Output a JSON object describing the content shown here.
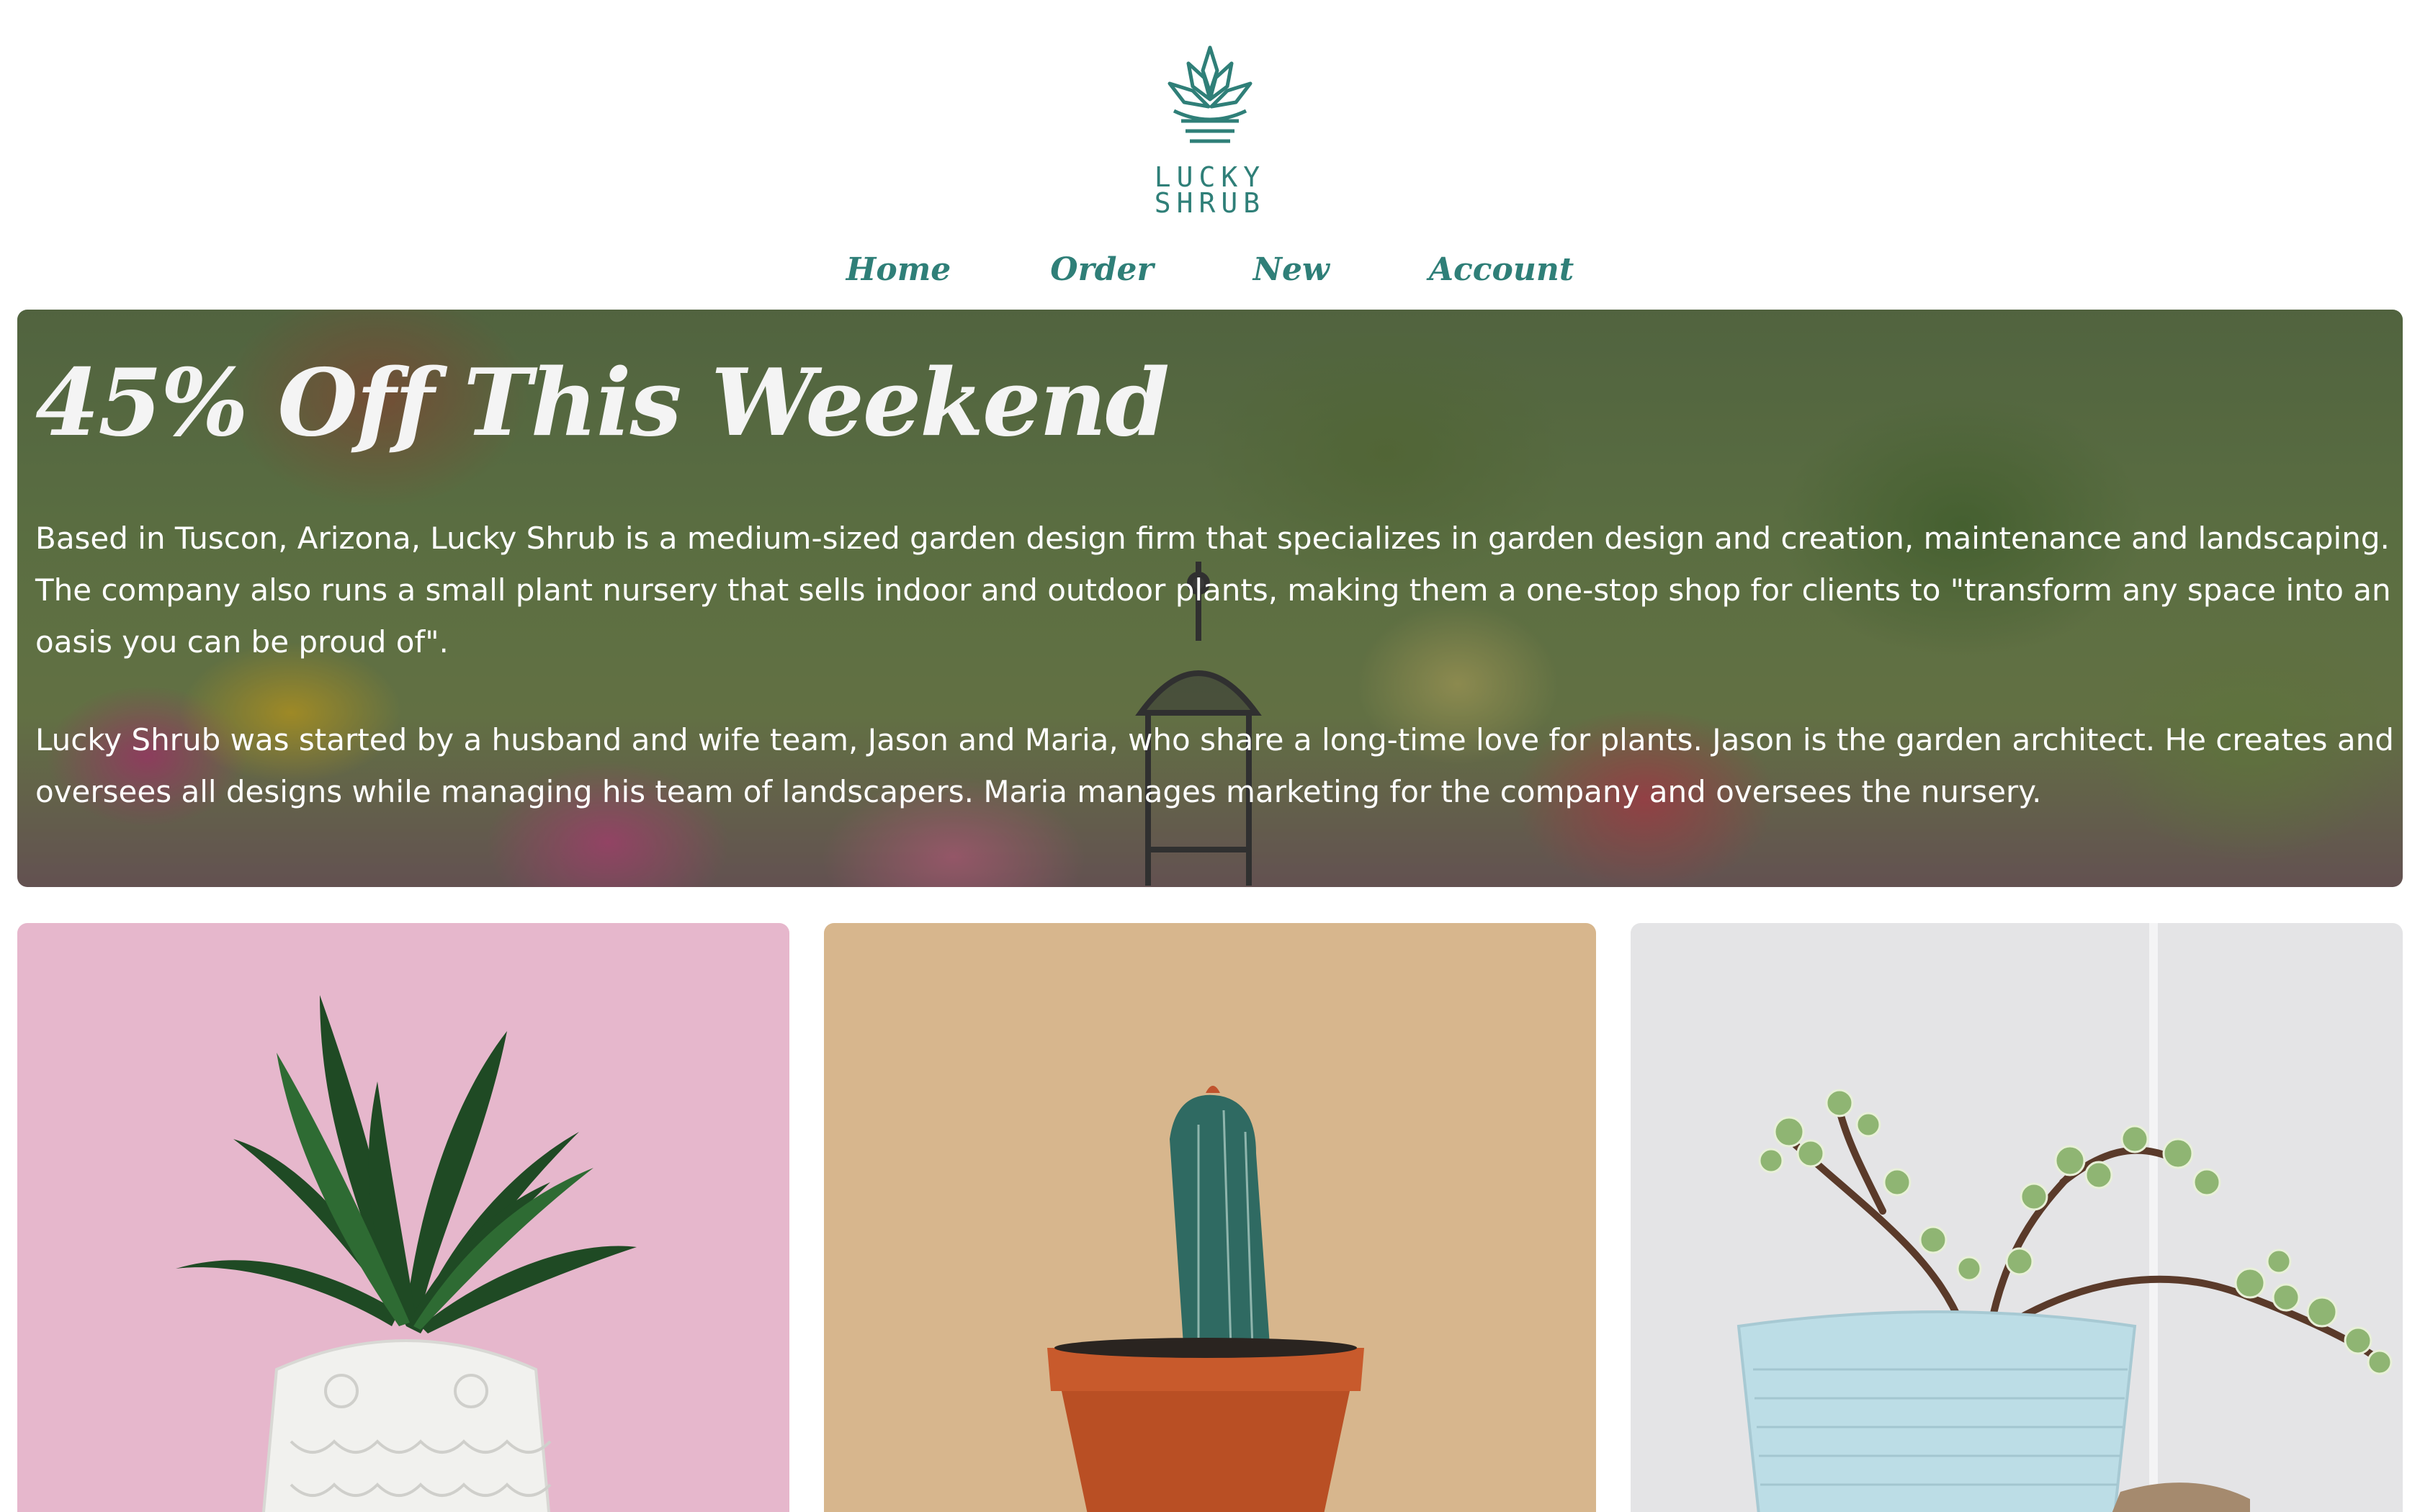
{
  "brand": {
    "logo_line1": "LUCKY",
    "logo_line2": "SHRUB",
    "logo_icon": "succulent-logo-icon",
    "brand_color": "#2f7f78"
  },
  "nav": {
    "items": [
      {
        "label": "Home"
      },
      {
        "label": "Order"
      },
      {
        "label": "New"
      },
      {
        "label": "Account"
      }
    ]
  },
  "hero": {
    "title": "45% Off This Weekend",
    "paragraph1": "Based in Tuscon, Arizona, Lucky Shrub is a medium-sized garden design firm that specializes in garden design and creation, maintenance and landscaping. The company also runs a small plant nursery that sells indoor and outdoor plants, making them a one-stop shop for clients to \"transform any space into an oasis you can be proud of\".",
    "paragraph2": "Lucky Shrub was started by a husband and wife team, Jason and Maria, who share a long-time love for plants. Jason is the garden architect. He creates and oversees all designs while managing his team of landscapers. Maria manages marketing for the company and oversees the nursery.",
    "image": "garden-lantern-photo"
  },
  "products": [
    {
      "image": "dracaena-owl-pot-photo",
      "background": "#e6b7cc"
    },
    {
      "image": "cactus-terracotta-pot-photo",
      "background": "#d7b68d"
    },
    {
      "image": "jade-plant-blue-pot-photo",
      "background": "#e4e4e6"
    }
  ]
}
